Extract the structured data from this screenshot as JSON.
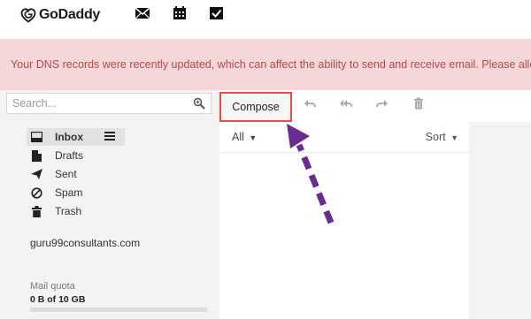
{
  "brand": {
    "name": "GoDaddy"
  },
  "header": {
    "icons": [
      "mail-icon",
      "calendar-icon",
      "tasks-icon"
    ]
  },
  "banner": {
    "text": "Your DNS records were recently updated, which can affect the ability to send and receive email. Please allow"
  },
  "search": {
    "placeholder": "Search..."
  },
  "toolbar": {
    "compose_label": "Compose",
    "icons": [
      "reply-icon",
      "reply-all-icon",
      "forward-icon",
      "delete-icon"
    ]
  },
  "folders": [
    {
      "label": "Inbox",
      "icon": "inbox-icon"
    },
    {
      "label": "Drafts",
      "icon": "draft-icon"
    },
    {
      "label": "Sent",
      "icon": "sent-icon"
    },
    {
      "label": "Spam",
      "icon": "spam-icon"
    },
    {
      "label": "Trash",
      "icon": "trash-icon"
    }
  ],
  "account": {
    "email": "guru99consultants.com"
  },
  "quota": {
    "label": "Mail quota",
    "value": "0 B of 10 GB",
    "fraction": 0
  },
  "list": {
    "filter_label": "All",
    "sort_label": "Sort"
  },
  "colors": {
    "banner_bg": "#f5d7d7",
    "banner_text": "#b54a4a",
    "highlight_border": "#e84a4a",
    "annotation_arrow": "#6a2c91"
  }
}
